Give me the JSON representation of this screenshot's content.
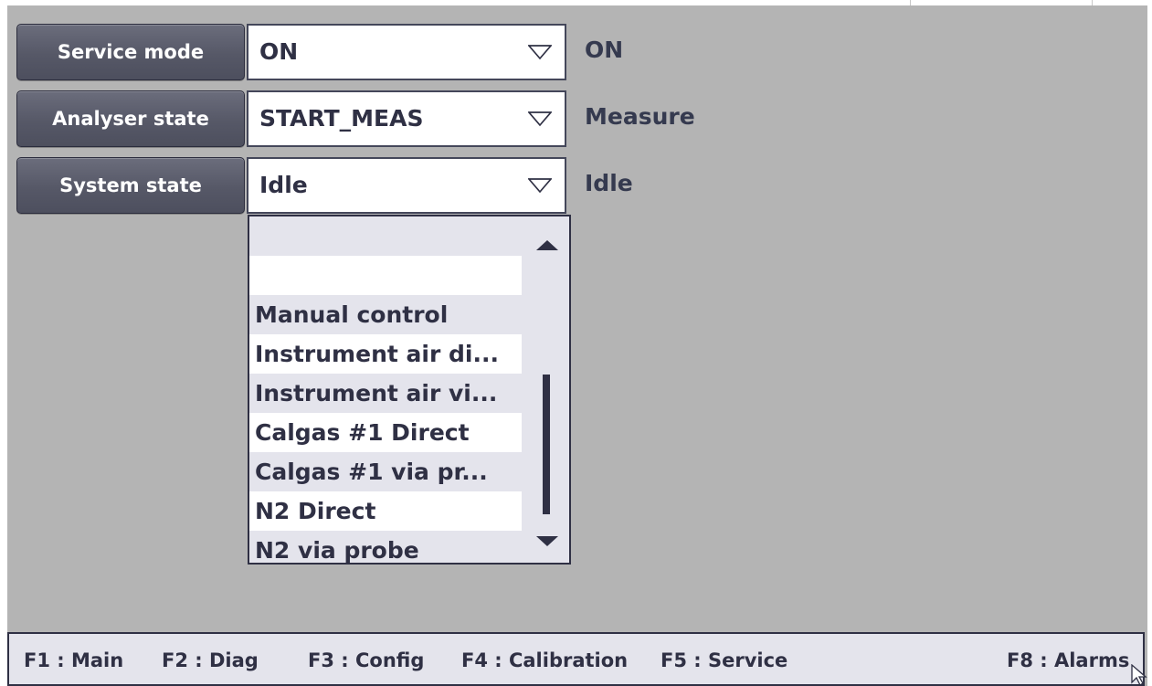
{
  "rows": [
    {
      "button_label": "Service mode",
      "selected_value": "ON",
      "status": "ON"
    },
    {
      "button_label": "Analyser state",
      "selected_value": "START_MEAS",
      "status": "Measure"
    },
    {
      "button_label": "System state",
      "selected_value": "Idle",
      "status": "Idle"
    }
  ],
  "dropdown": {
    "options": [
      "",
      "",
      "Manual control",
      "Instrument air di...",
      "Instrument air vi...",
      "Calgas #1 Direct",
      "Calgas #1 via pr...",
      "N2 Direct",
      "N2 via probe"
    ],
    "scroll_up_icon": "triangle-up-icon",
    "scroll_down_icon": "triangle-down-icon"
  },
  "footer": {
    "keys": [
      "F1 : Main",
      "F2 : Diag",
      "F3 : Config",
      "F4 : Calibration",
      "F5 : Service",
      "F8 : Alarms"
    ]
  },
  "colors": {
    "background": "#b4b4b4",
    "button": "#575968",
    "text": "#2f3044",
    "list": "#e4e4ec",
    "white": "#ffffff"
  },
  "icons": {
    "combo_caret": "chevron-down-outline-icon",
    "pointer": "mouse-pointer-icon"
  }
}
